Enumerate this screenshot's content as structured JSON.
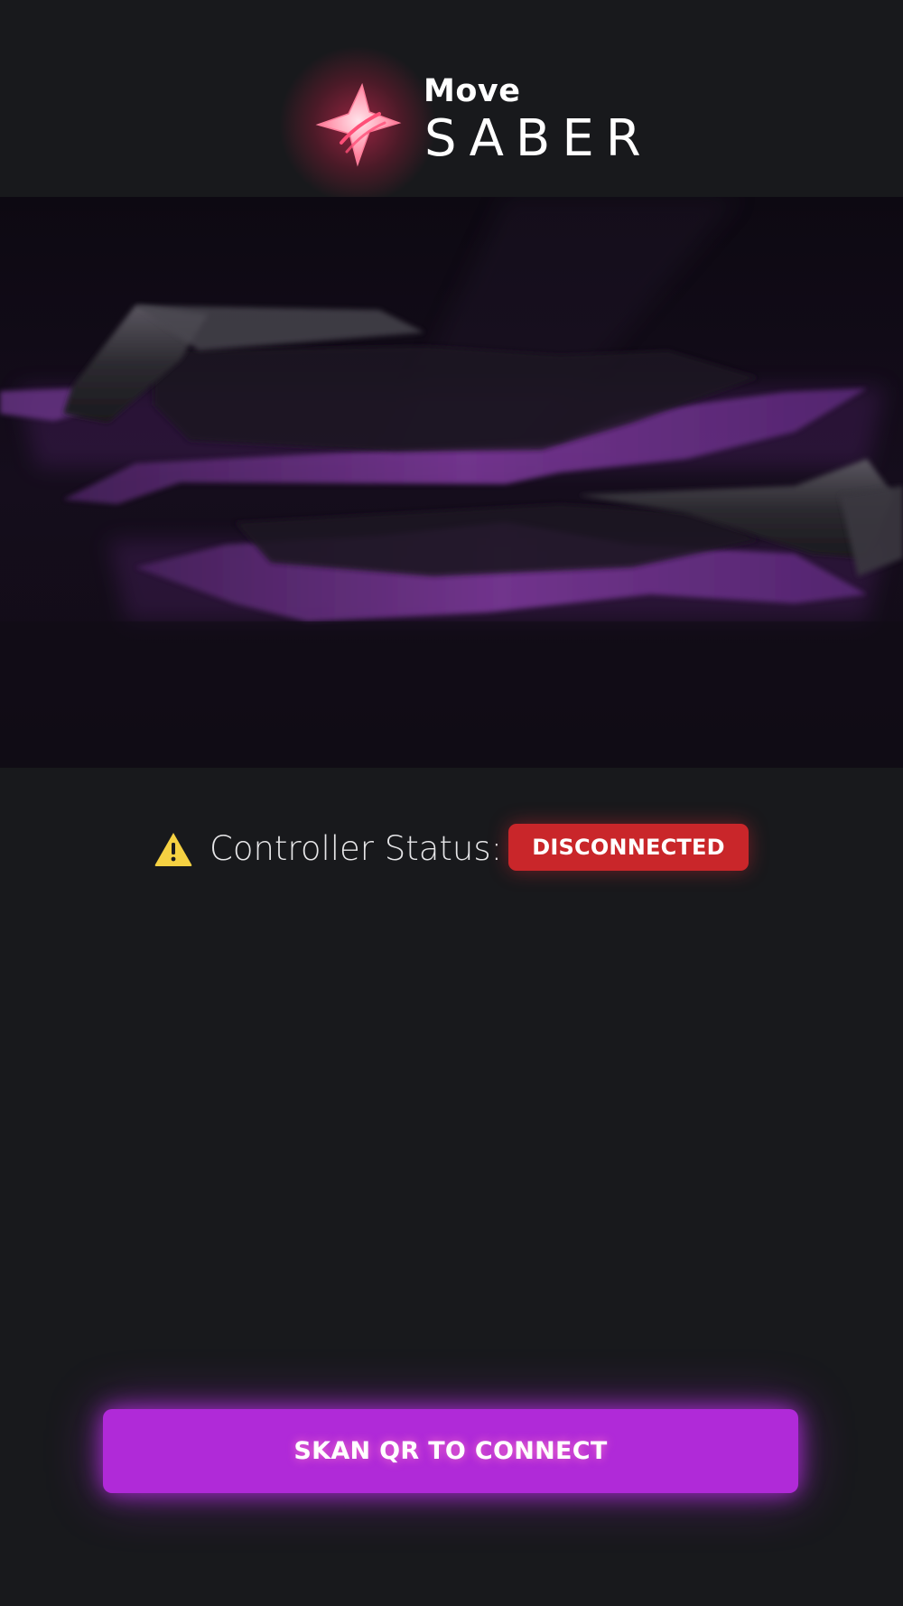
{
  "app": {
    "logo_text_small": "Move",
    "logo_text_big": "SABER",
    "logo_icon": "saber-star-logo",
    "colors": {
      "background": "#18191c",
      "logo_glow": "#ff2d5f",
      "accent_purple": "#b02ad8",
      "disconnected_red": "#c9262a",
      "warning_yellow": "#f5d142"
    }
  },
  "hero": {
    "image": "crossed-purple-lightsabers-artwork"
  },
  "status": {
    "icon": "warning-icon",
    "label": "Controller Status:",
    "badge": "DISCONNECTED"
  },
  "actions": {
    "primary_label": "SKAN QR TO CONNECT"
  }
}
